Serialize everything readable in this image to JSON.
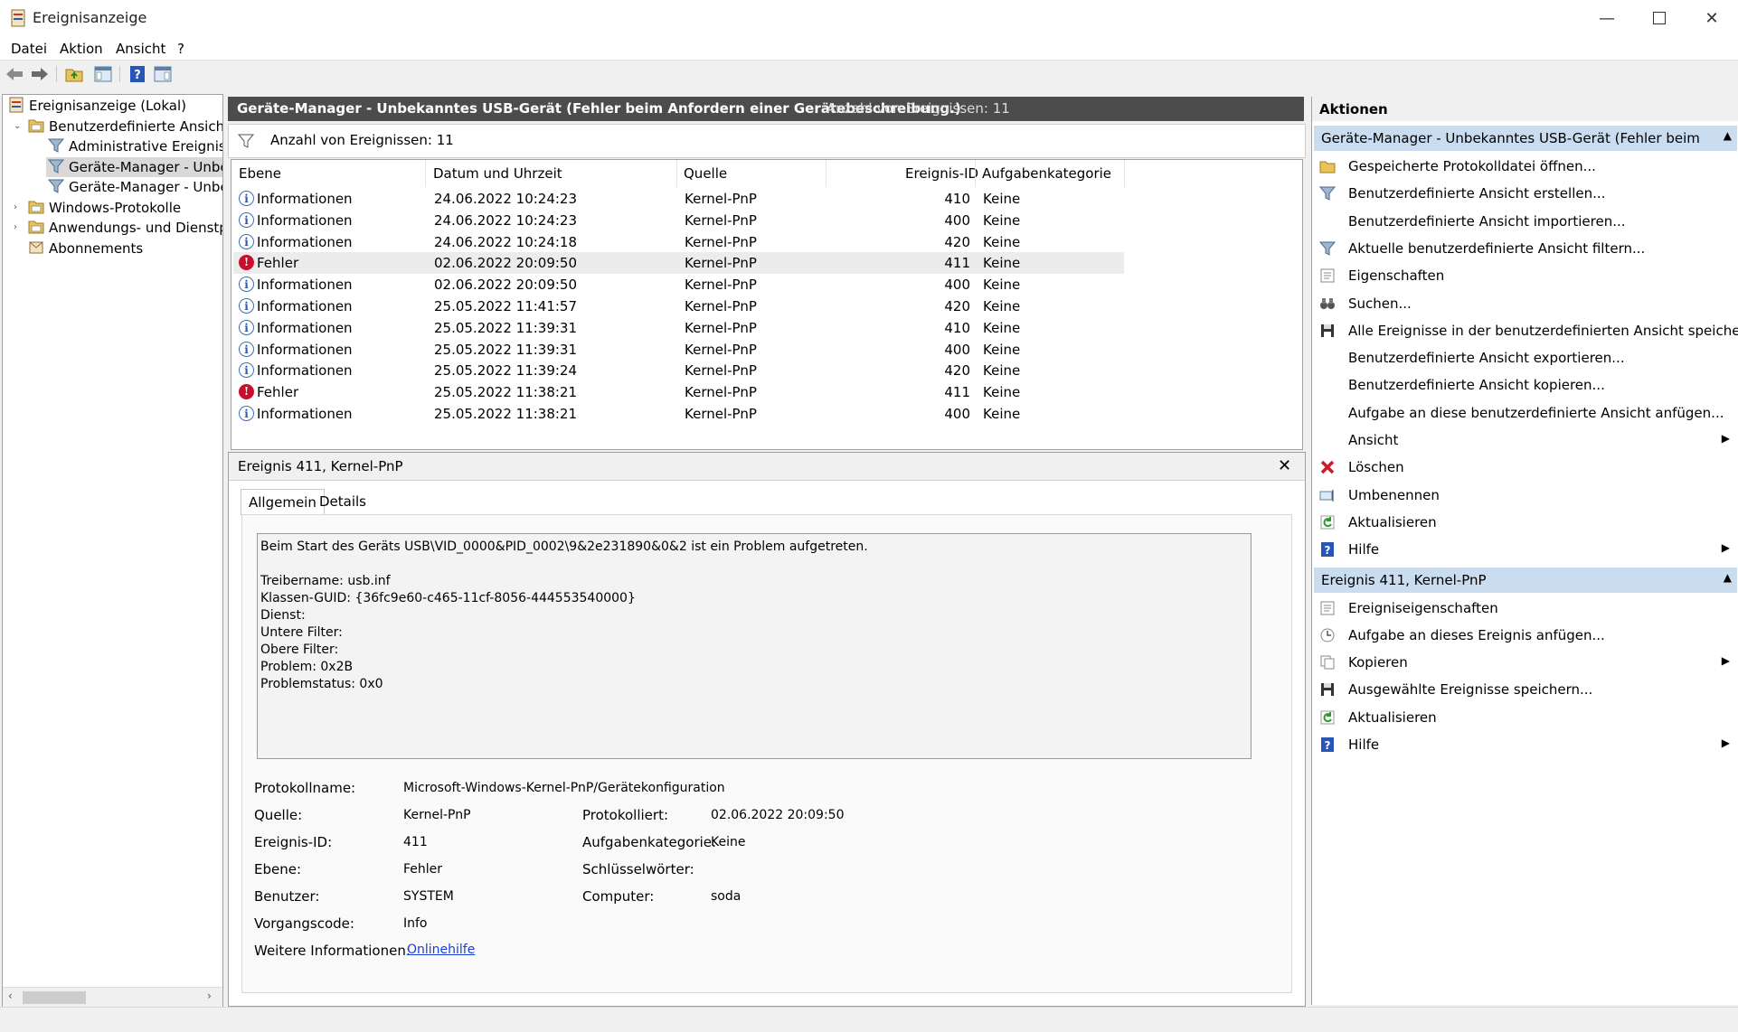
{
  "window": {
    "title": "Ereignisanzeige"
  },
  "menu": [
    "Datei",
    "Aktion",
    "Ansicht",
    "?"
  ],
  "tree": [
    {
      "label": "Ereignisanzeige (Lokal)",
      "indent": 0,
      "icon": "event-viewer-icon",
      "twist": "",
      "selected": false
    },
    {
      "label": "Benutzerdefinierte Ansichten",
      "indent": 1,
      "icon": "folder-icon",
      "twist": "v",
      "selected": false
    },
    {
      "label": "Administrative Ereignisse",
      "indent": 2,
      "icon": "filter-icon",
      "twist": "",
      "selected": false
    },
    {
      "label": "Geräte-Manager - Unbek",
      "indent": 2,
      "icon": "filter-icon",
      "twist": "",
      "selected": true
    },
    {
      "label": "Geräte-Manager - Unbek",
      "indent": 2,
      "icon": "filter-icon",
      "twist": "",
      "selected": false
    },
    {
      "label": "Windows-Protokolle",
      "indent": 1,
      "icon": "folder-icon",
      "twist": ">",
      "selected": false
    },
    {
      "label": "Anwendungs- und Dienstpro",
      "indent": 1,
      "icon": "folder-icon",
      "twist": ">",
      "selected": false
    },
    {
      "label": "Abonnements",
      "indent": 1,
      "icon": "subscriptions-icon",
      "twist": "",
      "selected": false
    }
  ],
  "center": {
    "header_title": "Geräte-Manager - Unbekanntes USB-Gerät (Fehler beim Anfordern einer Gerätebeschreibung.)",
    "header_count": "Anzahl von Ereignissen: 11",
    "filter_count": "Anzahl von Ereignissen: 11",
    "columns": [
      "Ebene",
      "Datum und Uhrzeit",
      "Quelle",
      "Ereignis-ID",
      "Aufgabenkategorie"
    ],
    "rows": [
      {
        "level": "Informationen",
        "type": "info",
        "date": "24.06.2022 10:24:23",
        "source": "Kernel-PnP",
        "id": "410",
        "cat": "Keine"
      },
      {
        "level": "Informationen",
        "type": "info",
        "date": "24.06.2022 10:24:23",
        "source": "Kernel-PnP",
        "id": "400",
        "cat": "Keine"
      },
      {
        "level": "Informationen",
        "type": "info",
        "date": "24.06.2022 10:24:18",
        "source": "Kernel-PnP",
        "id": "420",
        "cat": "Keine"
      },
      {
        "level": "Fehler",
        "type": "error",
        "date": "02.06.2022 20:09:50",
        "source": "Kernel-PnP",
        "id": "411",
        "cat": "Keine"
      },
      {
        "level": "Informationen",
        "type": "info",
        "date": "02.06.2022 20:09:50",
        "source": "Kernel-PnP",
        "id": "400",
        "cat": "Keine"
      },
      {
        "level": "Informationen",
        "type": "info",
        "date": "25.05.2022 11:41:57",
        "source": "Kernel-PnP",
        "id": "420",
        "cat": "Keine"
      },
      {
        "level": "Informationen",
        "type": "info",
        "date": "25.05.2022 11:39:31",
        "source": "Kernel-PnP",
        "id": "410",
        "cat": "Keine"
      },
      {
        "level": "Informationen",
        "type": "info",
        "date": "25.05.2022 11:39:31",
        "source": "Kernel-PnP",
        "id": "400",
        "cat": "Keine"
      },
      {
        "level": "Informationen",
        "type": "info",
        "date": "25.05.2022 11:39:24",
        "source": "Kernel-PnP",
        "id": "420",
        "cat": "Keine"
      },
      {
        "level": "Fehler",
        "type": "error",
        "date": "25.05.2022 11:38:21",
        "source": "Kernel-PnP",
        "id": "411",
        "cat": "Keine"
      },
      {
        "level": "Informationen",
        "type": "info",
        "date": "25.05.2022 11:38:21",
        "source": "Kernel-PnP",
        "id": "400",
        "cat": "Keine"
      }
    ],
    "selected_row": 3
  },
  "detail": {
    "title": "Ereignis 411, Kernel-PnP",
    "tabs": [
      "Allgemein",
      "Details"
    ],
    "message_lines": [
      "Beim Start des Geräts USB\\VID_0000&PID_0002\\9&2e231890&0&2 ist ein Problem aufgetreten.",
      "",
      "Treibername: usb.inf",
      "Klassen-GUID: {36fc9e60-c465-11cf-8056-444553540000}",
      "Dienst:",
      "Untere Filter:",
      "Obere Filter:",
      "Problem: 0x2B",
      "Problemstatus: 0x0"
    ],
    "fields": {
      "protokollname_label": "Protokollname:",
      "protokollname": "Microsoft-Windows-Kernel-PnP/Gerätekonfiguration",
      "quelle_label": "Quelle:",
      "quelle": "Kernel-PnP",
      "protokolliert_label": "Protokolliert:",
      "protokolliert": "02.06.2022 20:09:50",
      "id_label": "Ereignis-ID:",
      "id": "411",
      "kategorie_label": "Aufgabenkategorie:",
      "kategorie": "Keine",
      "ebene_label": "Ebene:",
      "ebene": "Fehler",
      "schluessel_label": "Schlüsselwörter:",
      "schluessel": "",
      "benutzer_label": "Benutzer:",
      "benutzer": "SYSTEM",
      "computer_label": "Computer:",
      "computer": "soda",
      "vorgang_label": "Vorgangscode:",
      "vorgang": "Info",
      "weitere_label": "Weitere Informationen:",
      "weitere_link": "Onlinehilfe"
    }
  },
  "actions": {
    "title": "Aktionen",
    "section1": "Geräte-Manager - Unbekanntes USB-Gerät (Fehler beim Anforde...",
    "items1": [
      {
        "label": "Gespeicherte Protokolldatei öffnen...",
        "icon": "open-folder-icon",
        "arrow": false
      },
      {
        "label": "Benutzerdefinierte Ansicht erstellen...",
        "icon": "filter-icon",
        "arrow": false
      },
      {
        "label": "Benutzerdefinierte Ansicht importieren...",
        "icon": "",
        "arrow": false
      },
      {
        "label": "Aktuelle benutzerdefinierte Ansicht filtern...",
        "icon": "filter-icon",
        "arrow": false
      },
      {
        "label": "Eigenschaften",
        "icon": "properties-icon",
        "arrow": false
      },
      {
        "label": "Suchen...",
        "icon": "binoculars-icon",
        "arrow": false
      },
      {
        "label": "Alle Ereignisse in der benutzerdefinierten Ansicht speichern ...",
        "icon": "save-icon",
        "arrow": false
      },
      {
        "label": "Benutzerdefinierte Ansicht exportieren...",
        "icon": "",
        "arrow": false
      },
      {
        "label": "Benutzerdefinierte Ansicht kopieren...",
        "icon": "",
        "arrow": false
      },
      {
        "label": "Aufgabe an diese benutzerdefinierte Ansicht anfügen...",
        "icon": "",
        "arrow": false
      },
      {
        "label": "Ansicht",
        "icon": "",
        "arrow": true
      },
      {
        "label": "Löschen",
        "icon": "delete-icon",
        "arrow": false
      },
      {
        "label": "Umbenennen",
        "icon": "rename-icon",
        "arrow": false
      },
      {
        "label": "Aktualisieren",
        "icon": "refresh-icon",
        "arrow": false
      },
      {
        "label": "Hilfe",
        "icon": "help-icon",
        "arrow": true
      }
    ],
    "section2": "Ereignis 411, Kernel-PnP",
    "items2": [
      {
        "label": "Ereigniseigenschaften",
        "icon": "properties-icon",
        "arrow": false
      },
      {
        "label": "Aufgabe an dieses Ereignis anfügen...",
        "icon": "task-icon",
        "arrow": false
      },
      {
        "label": "Kopieren",
        "icon": "copy-icon",
        "arrow": true
      },
      {
        "label": "Ausgewählte Ereignisse speichern...",
        "icon": "save-icon",
        "arrow": false
      },
      {
        "label": "Aktualisieren",
        "icon": "refresh-icon",
        "arrow": false
      },
      {
        "label": "Hilfe",
        "icon": "help-icon",
        "arrow": true
      }
    ]
  },
  "colors": {
    "header_bg": "#4c4c4c",
    "section_bg": "#c9dcf0",
    "error": "#c8102e",
    "info": "#3d6fb6",
    "link": "#1a3fd6"
  }
}
